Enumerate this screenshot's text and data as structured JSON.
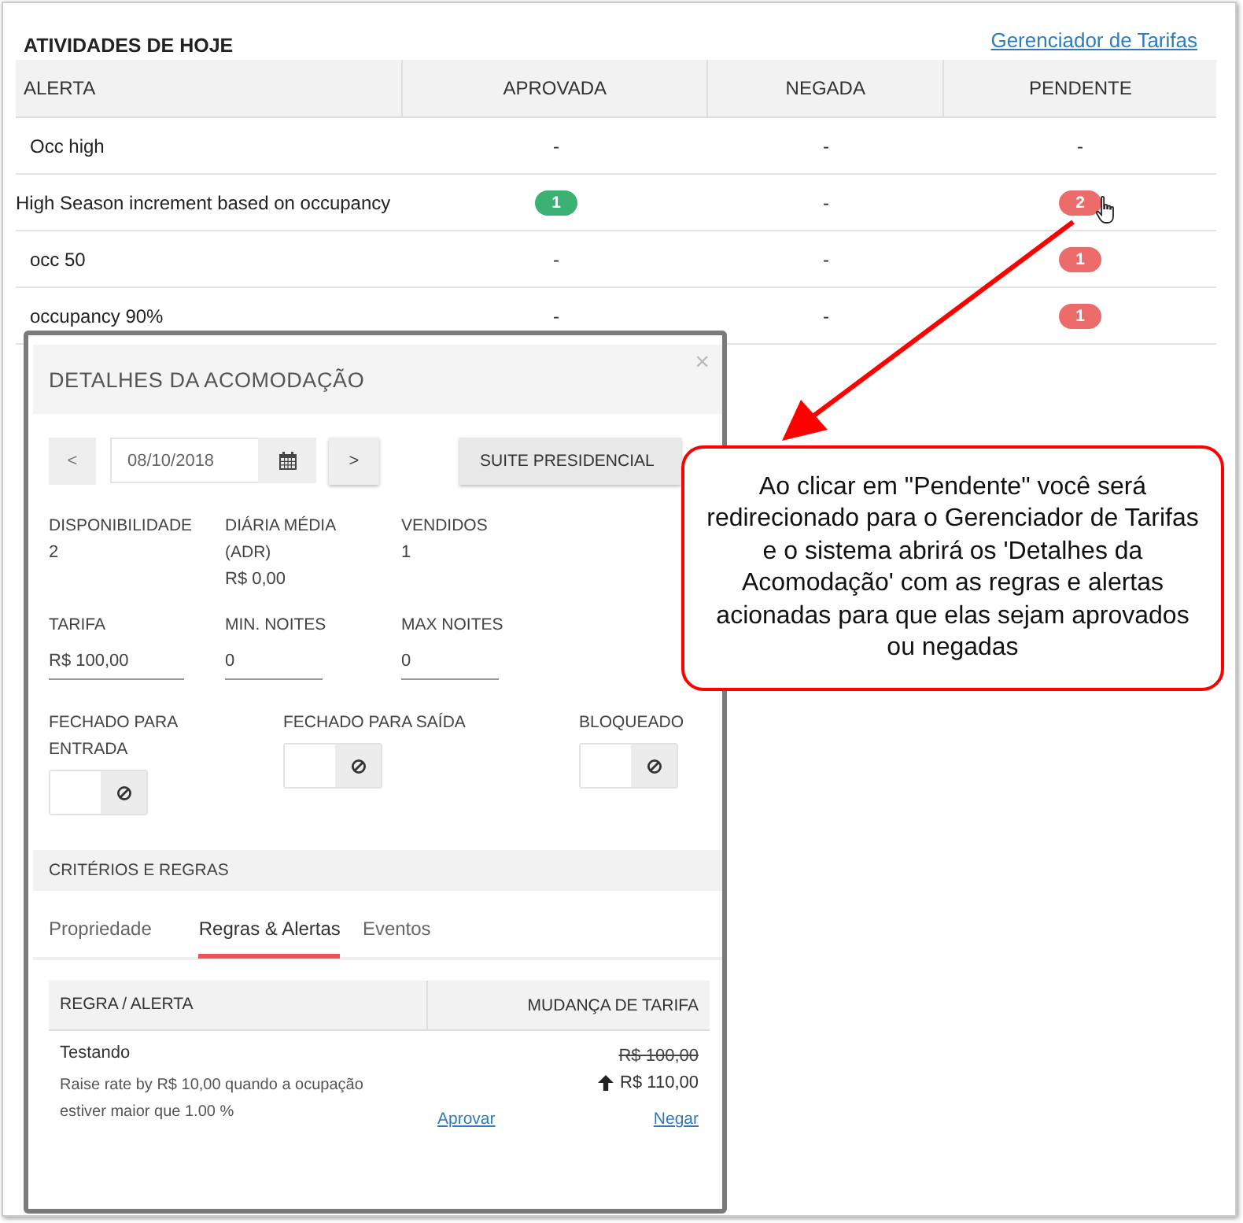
{
  "header": {
    "title": "ATIVIDADES DE HOJE",
    "link": "Gerenciador de Tarifas"
  },
  "table": {
    "columns": [
      "ALERTA",
      "APROVADA",
      "NEGADA",
      "PENDENTE"
    ],
    "rows": [
      {
        "cells": [
          {
            "kind": "text",
            "text": "Occ high",
            "indent": true
          },
          {
            "kind": "dash",
            "text": "-"
          },
          {
            "kind": "dash",
            "text": "-"
          },
          {
            "kind": "dash",
            "text": "-"
          }
        ]
      },
      {
        "cells": [
          {
            "kind": "text",
            "text": "High Season increment based on occupancy",
            "indent": false
          },
          {
            "kind": "badge",
            "text": "1",
            "color": "#3bb273"
          },
          {
            "kind": "dash",
            "text": "-"
          },
          {
            "kind": "badge",
            "text": "2",
            "color": "#ec6b6b",
            "cursor": true
          }
        ]
      },
      {
        "cells": [
          {
            "kind": "text",
            "text": "occ 50",
            "indent": true
          },
          {
            "kind": "dash",
            "text": "-"
          },
          {
            "kind": "dash",
            "text": "-"
          },
          {
            "kind": "badge",
            "text": "1",
            "color": "#ec6b6b"
          }
        ]
      },
      {
        "cells": [
          {
            "kind": "text",
            "text": "occupancy 90%",
            "indent": true
          },
          {
            "kind": "dash",
            "text": "-"
          },
          {
            "kind": "dash",
            "text": "-"
          },
          {
            "kind": "badge",
            "text": "1",
            "color": "#ec6b6b"
          }
        ]
      }
    ]
  },
  "modal": {
    "title": "DETALHES DA ACOMODAÇÃO",
    "close": "×",
    "prev": "<",
    "date": "08/10/2018",
    "next": ">",
    "room": "SUITE PRESIDENCIAL",
    "stats": [
      {
        "label": "DISPONIBILIDADE",
        "value": "2"
      },
      {
        "label": "DIÁRIA MÉDIA (ADR)",
        "value": "R$ 0,00"
      },
      {
        "label": "VENDIDOS",
        "value": "1"
      }
    ],
    "inputs": [
      {
        "label": "TARIFA",
        "value": "R$ 100,00"
      },
      {
        "label": "MIN. NOITES",
        "value": "0"
      },
      {
        "label": "MAX NOITES",
        "value": "0"
      }
    ],
    "toggles": [
      {
        "label": "FECHADO PARA ENTRADA",
        "on": false
      },
      {
        "label": "FECHADO PARA SAÍDA",
        "on": false
      },
      {
        "label": "BLOQUEADO",
        "on": false
      }
    ],
    "section": "CRITÉRIOS E REGRAS",
    "tabs": [
      {
        "label": "Propriedade",
        "selected": false
      },
      {
        "label": "Regras & Alertas",
        "selected": true
      },
      {
        "label": "Eventos",
        "selected": false
      }
    ],
    "rules": {
      "columns": [
        "REGRA / ALERTA",
        "MUDANÇA DE TARIFA"
      ],
      "rows": [
        {
          "name": "Testando",
          "description": "Raise rate by R$ 10,00 quando a ocupação estiver maior que 1.00 %",
          "old_rate": "R$ 100,00",
          "new_rate": "R$ 110,00",
          "approve": "Aprovar",
          "deny": "Negar"
        }
      ]
    }
  },
  "callout": {
    "text": "Ao clicar em \"Pendente\" você será redirecionado para o Gerenciador de Tarifas e o sistema abrirá os 'Detalhes da Acomodação' com as regras e alertas acionadas para que elas sejam aprovados ou negadas"
  }
}
